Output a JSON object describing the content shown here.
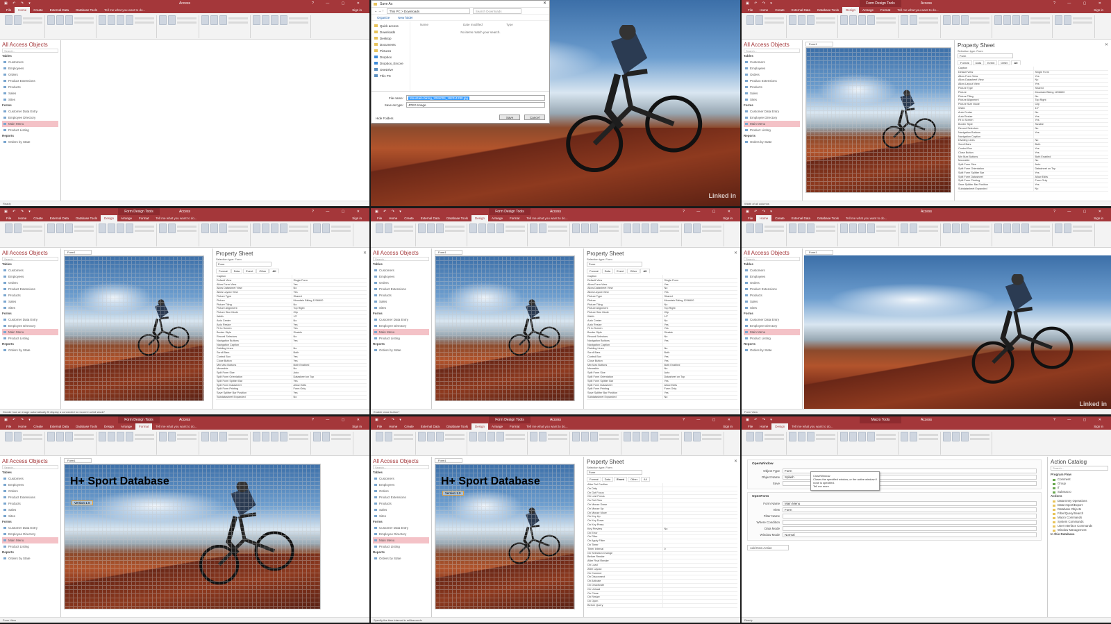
{
  "tabs": {
    "file": "File",
    "home": "Home",
    "create": "Create",
    "external": "External Data",
    "dbtools": "Database Tools",
    "design": "Design",
    "arrange": "Arrange",
    "format": "Format",
    "tellme": "Tell me what you want to do...",
    "signin": "Sign in"
  },
  "titles": {
    "app": "Access",
    "formtools": "Form Design Tools",
    "macrotools": "Macro Tools"
  },
  "nav": {
    "title": "All Access Objects",
    "search": "Search...",
    "tables_label": "Tables",
    "tables": [
      "Customers",
      "Employees",
      "Orders",
      "Product Extensions",
      "Products",
      "Sales",
      "Sites"
    ],
    "forms_label": "Forms",
    "forms": [
      "Customer Data Entry",
      "Employee Directory",
      "Main Menu",
      "Product Listing"
    ],
    "reports_label": "Reports",
    "reports": [
      "Orders by State"
    ]
  },
  "doc": {
    "tab": "Form1"
  },
  "status": {
    "p0": "Ready",
    "p2": "Width of all columns",
    "p3": "Decide how an image automatically fit display a connected to record in a full stack?",
    "p4": "Enable close button?",
    "p5": "Form View",
    "p6": "Form View",
    "p7": "Specify the time interval in milliseconds",
    "p8": "Ready"
  },
  "saveas": {
    "title": "Save As",
    "path": "This PC  >  Downloads",
    "search": "Search Downloads",
    "organize": "Organize",
    "newfolder": "New folder",
    "tree": [
      "Quick access",
      "Downloads",
      "Desktop",
      "Documents",
      "Pictures",
      "Dropbox",
      "Dropbox_Encore",
      "OneDrive",
      "This PC"
    ],
    "col_name": "Name",
    "col_date": "Date modified",
    "col_type": "Type",
    "empty": "No items match your search.",
    "filename_label": "File name:",
    "filename": "Mountain-biking_2084004_1920x1280.jpg",
    "savetype_label": "Save as type:",
    "savetype": "JPEG Image",
    "hide": "Hide Folders",
    "save": "Save",
    "cancel": "Cancel"
  },
  "propsheet": {
    "title": "Property Sheet",
    "seltype": "Selection type:  Form",
    "selected": "Form",
    "tab_format": "Format",
    "tab_data": "Data",
    "tab_event": "Event",
    "tab_other": "Other",
    "tab_all": "All",
    "rows_a": [
      [
        "Caption",
        ""
      ],
      [
        "Default View",
        "Single Form"
      ],
      [
        "Allow Form View",
        "Yes"
      ],
      [
        "Allow Datasheet View",
        "No"
      ],
      [
        "Allow Layout View",
        "Yes"
      ],
      [
        "Picture Type",
        "Shared"
      ],
      [
        "Picture",
        "Mountain Biking 1206600"
      ],
      [
        "Picture Tiling",
        "No"
      ],
      [
        "Picture Alignment",
        "Top Right"
      ],
      [
        "Picture Size Mode",
        "Clip"
      ],
      [
        "Width",
        "10\""
      ],
      [
        "Auto Center",
        "No"
      ],
      [
        "Auto Resize",
        "Yes"
      ],
      [
        "Fit to Screen",
        "Yes"
      ],
      [
        "Border Style",
        "Sizable"
      ],
      [
        "Record Selectors",
        "No"
      ],
      [
        "Navigation Buttons",
        "Yes"
      ],
      [
        "Navigation Caption",
        ""
      ],
      [
        "Dividing Lines",
        "No"
      ],
      [
        "Scroll Bars",
        "Both"
      ],
      [
        "Control Box",
        "Yes"
      ],
      [
        "Close Button",
        "Yes"
      ],
      [
        "Min Max Buttons",
        "Both Enabled"
      ],
      [
        "Moveable",
        "No"
      ],
      [
        "Split Form Size",
        "Auto"
      ],
      [
        "Split Form Orientation",
        "Datasheet on Top"
      ],
      [
        "Split Form Splitter Bar",
        "Yes"
      ],
      [
        "Split Form Datasheet",
        "Allow Edits"
      ],
      [
        "Split Form Printing",
        "Form Only"
      ],
      [
        "Save Splitter Bar Position",
        "Yes"
      ],
      [
        "Subdatasheet Expanded",
        "No"
      ]
    ],
    "rows_e": [
      [
        "After Del Confirm",
        ""
      ],
      [
        "On Dirty",
        ""
      ],
      [
        "On Got Focus",
        ""
      ],
      [
        "On Lost Focus",
        ""
      ],
      [
        "On Dbl Click",
        ""
      ],
      [
        "On Mouse Down",
        ""
      ],
      [
        "On Mouse Up",
        ""
      ],
      [
        "On Mouse Move",
        ""
      ],
      [
        "On Key Up",
        ""
      ],
      [
        "On Key Down",
        ""
      ],
      [
        "On Key Press",
        ""
      ],
      [
        "Key Preview",
        "No"
      ],
      [
        "On Error",
        ""
      ],
      [
        "On Filter",
        ""
      ],
      [
        "On Apply Filter",
        ""
      ],
      [
        "On Timer",
        ""
      ],
      [
        "Timer Interval",
        "0"
      ],
      [
        "On Selection Change",
        ""
      ],
      [
        "Before Render",
        ""
      ],
      [
        "After Final Render",
        ""
      ],
      [
        "On Load",
        ""
      ],
      [
        "After Layout",
        ""
      ],
      [
        "On Connect",
        ""
      ],
      [
        "On Disconnect",
        ""
      ],
      [
        "On Activate",
        ""
      ],
      [
        "On Deactivate",
        ""
      ],
      [
        "On Unload",
        ""
      ],
      [
        "On Close",
        ""
      ],
      [
        "On Resize",
        ""
      ],
      [
        "On Open",
        ""
      ],
      [
        "Before Query",
        ""
      ]
    ]
  },
  "overlay": {
    "title": "H+ Sport Database",
    "version": "Version 1.0"
  },
  "macro": {
    "block1": "OpenWindow",
    "object_type_label": "Object Type",
    "object_type": "Form",
    "object_name_label": "Object Name",
    "object_name": "Splash",
    "save_label": "Save",
    "tip_title": "CloseWindow",
    "tip_body": "Closes the specified window, or the active window if none is specified.",
    "tip_more": "Tell me more",
    "block2": "OpenForm",
    "form_name_label": "Form Name",
    "form_name": "Main Menu",
    "view_label": "View",
    "view": "Form",
    "filter_label": "Filter Name",
    "filter": "",
    "where_label": "Where Condition",
    "where": "",
    "data_label": "Data Mode",
    "data": "",
    "window_label": "Window Mode",
    "window": "Normal",
    "add": "Add New Action",
    "catalog_title": "Action Catalog",
    "catalog_search": "Search...",
    "program_flow": "Program Flow",
    "flow_items": [
      "Comment",
      "Group",
      "If",
      "Submacro"
    ],
    "actions": "Actions",
    "action_items": [
      "Data Entry Operations",
      "Data Import/Export",
      "Database Objects",
      "Filter/Query/Search",
      "Macro Commands",
      "System Commands",
      "User Interface Commands",
      "Window Management"
    ],
    "in_db": "In this Database"
  },
  "watermark": "Linked in"
}
